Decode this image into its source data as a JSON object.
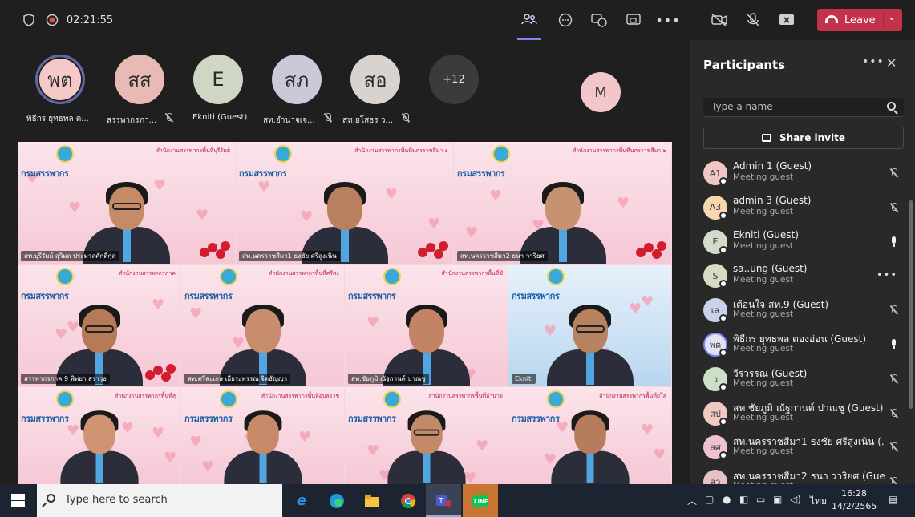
{
  "topbar": {
    "timer": "02:21:55",
    "leave_label": "Leave"
  },
  "strip": {
    "participants": [
      {
        "initials": "พต",
        "name": "พิธีกร ยุทธพล ต...",
        "color": "#f4c9c7",
        "muted": false,
        "active": true
      },
      {
        "initials": "สส",
        "name": "สรรพากรภา...",
        "color": "#e9b9b4",
        "muted": true,
        "active": false
      },
      {
        "initials": "E",
        "name": "Ekniti (Guest)",
        "color": "#cfd6c4",
        "muted": false,
        "active": false
      },
      {
        "initials": "สภ",
        "name": "สท.อำนาจเจ...",
        "color": "#c9c9d9",
        "muted": true,
        "active": false
      },
      {
        "initials": "สอ",
        "name": "สท.ยโสธร ว...",
        "color": "#d8d3cf",
        "muted": true,
        "active": false
      }
    ],
    "overflow": "+12",
    "side_avatar": "M"
  },
  "video": {
    "tiles": [
      {
        "header": "สำนักงานสรรพากรพื้นที่บุรีรัมย์",
        "tag": "สท.บุรีรัมย์ สุวิมล ประมวลศักดิ์กุล",
        "brand": "กรมสรรพากร",
        "roses": true
      },
      {
        "header": "สำนักงานสรรพากรพื้นที่นครราชสีมา ๑",
        "tag": "สท.นครราชสีมา1 ธงชัย ศรีสูงเนิน",
        "brand": "กรมสรรพากร",
        "roses": true
      },
      {
        "header": "สำนักงานสรรพากรพื้นที่นครราชสีมา ๒",
        "tag": "สท.นครราชสีมา2 ธนา วาริยศ",
        "brand": "กรมสรรพากร",
        "roses": true
      },
      {
        "header": "สำนักงานสรรพากรภาค",
        "tag": "สรรพากรภาค 9 พิทยา สราวุธ",
        "brand": "กรมสรรพากร",
        "roses": true
      },
      {
        "header": "สำนักงานสรรพากรพื้นที่ศรีสะ",
        "tag": "สท.ศรีสะเกษ เยียระพรรณ จิตธัญญา",
        "brand": "กรมสรรพากร",
        "roses": false
      },
      {
        "header": "สำนักงานสรรพากรพื้นที่ชั",
        "tag": "สท.ชัยภูมิ ณัฐกานต์ ปาณชู",
        "brand": "กรมสรรพากร",
        "roses": false
      },
      {
        "header": "",
        "tag": "Ekniti",
        "brand": "กรมสรรพากร",
        "roses": false
      },
      {
        "header": "สำนักงานสรรพากรพื้นที่สุ",
        "tag": "",
        "brand": "กรมสรรพากร",
        "roses": false
      },
      {
        "header": "สำนักงานสรรพากรพื้นที่อุบลราช",
        "tag": "",
        "brand": "กรมสรรพากร",
        "roses": false
      },
      {
        "header": "สำนักงานสรรพากรพื้นที่อำนาจ",
        "tag": "",
        "brand": "กรมสรรพากร",
        "roses": false
      },
      {
        "header": "สำนักงานสรรพากรพื้นที่ยโส",
        "tag": "",
        "brand": "กรมสรรพากร",
        "roses": false
      }
    ]
  },
  "panel": {
    "title": "Participants",
    "search_placeholder": "Type a name",
    "invite_label": "Share invite",
    "people": [
      {
        "initials": "A1",
        "name": "Admin 1 (Guest)",
        "role": "Meeting guest",
        "color": "#f1c7c5",
        "mic": "off"
      },
      {
        "initials": "A3",
        "name": "admin 3 (Guest)",
        "role": "Meeting guest",
        "color": "#f6d7b0",
        "mic": "off"
      },
      {
        "initials": "E",
        "name": "Ekniti (Guest)",
        "role": "Meeting guest",
        "color": "#d3dccb",
        "mic": "on"
      },
      {
        "initials": "S",
        "name": "sa..ung (Guest)",
        "role": "Meeting guest",
        "color": "#d6dcc6",
        "mic": "more"
      },
      {
        "initials": "เส",
        "name": "เตือนใจ สท.9 (Guest)",
        "role": "Meeting guest",
        "color": "#c9d2e8",
        "mic": "off"
      },
      {
        "initials": "พต",
        "name": "พิธีกร ยุทธพล ตองอ่อน (Guest)",
        "role": "Meeting guest",
        "color": "#e2e2f4",
        "mic": "on"
      },
      {
        "initials": "ว",
        "name": "วีรวรรณ (Guest)",
        "role": "Meeting guest",
        "color": "#cde0c6",
        "mic": "off"
      },
      {
        "initials": "สป",
        "name": "สท ชัยภูมิ ณัฐกานต์ ปาณชู (Guest)",
        "role": "Meeting guest",
        "color": "#f1c8c2",
        "mic": "off"
      },
      {
        "initials": "สศ",
        "name": "สท.นครราชสีมา1 ธงชัย ศรีสูงเนิน (...",
        "role": "Meeting guest",
        "color": "#eec1cf",
        "mic": "off"
      },
      {
        "initials": "สว",
        "name": "สท.นครราชสีมา2 ธนา วาริยศ (Gue...",
        "role": "Meeting guest",
        "color": "#e6c2c8",
        "mic": "off"
      }
    ]
  },
  "taskbar": {
    "search_placeholder": "Type here to search",
    "lang": "ไทย",
    "time": "16:28",
    "date": "14/2/2565"
  }
}
